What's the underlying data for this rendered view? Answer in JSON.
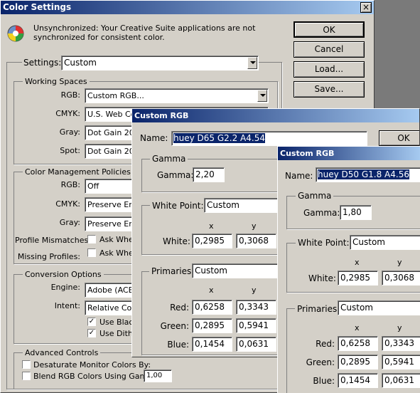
{
  "color_settings": {
    "title": "Color Settings",
    "close_glyph": "×",
    "sync_message_1": "Unsynchronized: Your Creative Suite applications are not",
    "sync_message_2": "synchronized for consistent color.",
    "buttons": {
      "ok": "OK",
      "cancel": "Cancel",
      "load": "Load...",
      "save": "Save..."
    },
    "settings_label": "Settings:",
    "settings_value": "Custom",
    "working_spaces": {
      "title": "Working Spaces",
      "rgb_label": "RGB:",
      "rgb_value": "Custom RGB...",
      "cmyk_label": "CMYK:",
      "cmyk_value": "U.S. Web Coa",
      "gray_label": "Gray:",
      "gray_value": "Dot Gain 20%",
      "spot_label": "Spot:",
      "spot_value": "Dot Gain 20%"
    },
    "policies": {
      "title": "Color Management Policies",
      "rgb_label": "RGB:",
      "rgb_value": "Off",
      "cmyk_label": "CMYK:",
      "cmyk_value": "Preserve Emb",
      "gray_label": "Gray:",
      "gray_value": "Preserve Emb",
      "mismatch_label": "Profile Mismatches:",
      "mismatch_check": "Ask Wher",
      "missing_label": "Missing Profiles:",
      "missing_check": "Ask Wher"
    },
    "conversion": {
      "title": "Conversion Options",
      "engine_label": "Engine:",
      "engine_value": "Adobe (ACE)",
      "intent_label": "Intent:",
      "intent_value": "Relative Color",
      "blackpoint_label": "Use Black",
      "dither_label": "Use Dither"
    },
    "advanced": {
      "title": "Advanced Controls",
      "desaturate_label": "Desaturate Monitor Colors By:",
      "blend_label": "Blend RGB Colors Using Gamma:",
      "blend_value": "1,00"
    }
  },
  "custom_rgb_1": {
    "title": "Custom RGB",
    "name_label": "Name:",
    "name_value": "huey D65 G2.2 A4.54",
    "ok": "OK",
    "gamma_group": "Gamma",
    "gamma_label": "Gamma:",
    "gamma_value": "2,20",
    "wp_label": "White Point:",
    "wp_value": "Custom",
    "x_head": "x",
    "y_head": "y",
    "white_label": "White:",
    "white_x": "0,2985",
    "white_y": "0,3068",
    "prim_label": "Primaries:",
    "prim_value": "Custom",
    "red_label": "Red:",
    "red_x": "0,6258",
    "red_y": "0,3343",
    "green_label": "Green:",
    "green_x": "0,2895",
    "green_y": "0,5941",
    "blue_label": "Blue:",
    "blue_x": "0,1454",
    "blue_y": "0,0631"
  },
  "custom_rgb_2": {
    "title": "Custom RGB",
    "name_label": "Name:",
    "name_value": "huey D50 G1.8 A4.56",
    "gamma_group": "Gamma",
    "gamma_label": "Gamma:",
    "gamma_value": "1,80",
    "wp_label": "White Point:",
    "wp_value": "Custom",
    "x_head": "x",
    "y_head": "y",
    "white_label": "White:",
    "white_x": "0,2985",
    "white_y": "0,3068",
    "prim_label": "Primaries:",
    "prim_value": "Custom",
    "red_label": "Red:",
    "red_x": "0,6258",
    "red_y": "0,3343",
    "green_label": "Green:",
    "green_x": "0,2895",
    "green_y": "0,5941",
    "blue_label": "Blue:",
    "blue_x": "0,1454",
    "blue_y": "0,0631"
  },
  "colors": {
    "titlebar": "#0a246a",
    "face": "#d4d0c8",
    "selection": "#0a246a"
  }
}
